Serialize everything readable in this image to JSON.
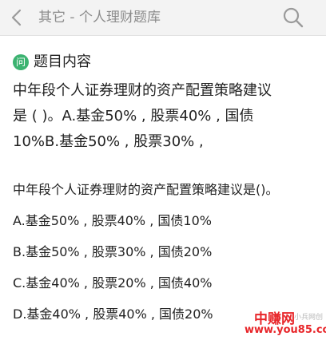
{
  "header": {
    "title": "其它 - 个人理财题库",
    "back_icon": "chevron-left-icon",
    "search_icon": "search-icon"
  },
  "section": {
    "badge": "问",
    "title": "题目内容"
  },
  "question": {
    "lines": [
      "中年段个人证券理财的资产配置策略建议",
      "是 ( )。A.基金50% , 股票40% , 国债",
      "10%B.基金50% , 股票30% ,"
    ]
  },
  "detail": {
    "stem": "中年段个人证券理财的资产配置策略建议是()。",
    "options": [
      "A.基金50% , 股票40% , 国债10%",
      "B.基金50% , 股票30% , 国债20%",
      "C.基金40% , 股票20% , 国债40%",
      "D.基金40% , 股票40% , 国债20%"
    ]
  },
  "watermark": {
    "brand": "中赚网",
    "side_text": "小兵网创",
    "url": "www.you85.com"
  },
  "colors": {
    "header_bg": "#f3f3f3",
    "header_text": "#8c8c8c",
    "badge_green": "#3cb371",
    "watermark_red": "#e8262a"
  }
}
